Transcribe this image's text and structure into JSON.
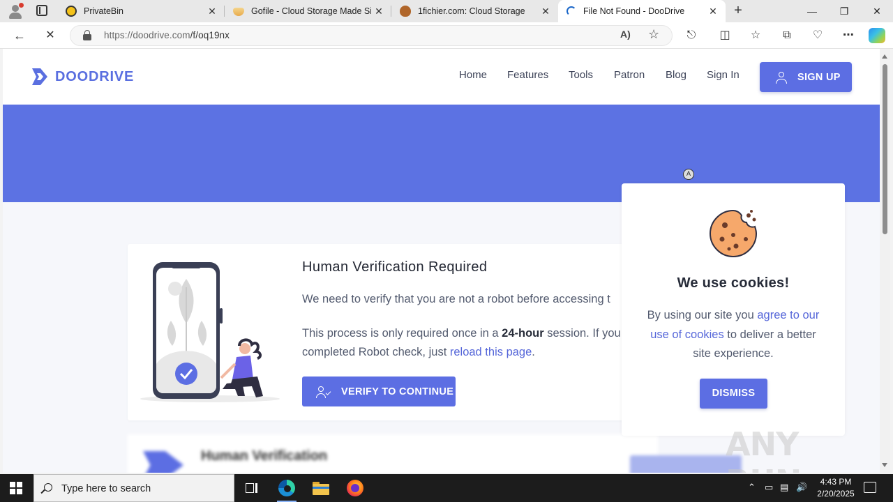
{
  "browser": {
    "tabs": [
      {
        "title": "PrivateBin",
        "active": false
      },
      {
        "title": "Gofile - Cloud Storage Made Sim",
        "active": false
      },
      {
        "title": "1fichier.com: Cloud Storage",
        "active": false
      },
      {
        "title": "File Not Found - DooDrive",
        "active": true
      }
    ],
    "close_glyph": "✕",
    "new_tab_glyph": "+",
    "url_host": "https://doodrive.com",
    "url_path": "/f/oq19nx",
    "read_aloud_glyph": "A)",
    "window_controls": {
      "minimize": "—",
      "maximize": "❐",
      "close": "✕"
    }
  },
  "site": {
    "logo_text": "DOODRIVE",
    "nav": [
      "Home",
      "Features",
      "Tools",
      "Patron",
      "Blog",
      "Sign In"
    ],
    "signup_label": "SIGN UP",
    "accent_color": "#5c6ee3"
  },
  "verification": {
    "title": "Human Verification Required",
    "line1": "We need to verify that you are not a robot before accessing t",
    "line2_pre": "This process is only required once in a ",
    "line2_bold": "24-hour",
    "line2_post": " session. If you",
    "line3_pre": "completed Robot check, just ",
    "line3_link": "reload this page",
    "line3_post": ".",
    "button_label": "VERIFY TO CONTINUE"
  },
  "blurred_card": {
    "title": "Human Verification"
  },
  "cookie": {
    "title": "We use cookies!",
    "text_pre": "By using our site you ",
    "text_link": "agree to our use of cookies",
    "text_post": " to deliver a better site experience.",
    "dismiss_label": "DISMISS"
  },
  "watermark": "ANY RUN",
  "taskbar": {
    "search_placeholder": "Type here to search",
    "time": "4:43 PM",
    "date": "2/20/2025"
  }
}
